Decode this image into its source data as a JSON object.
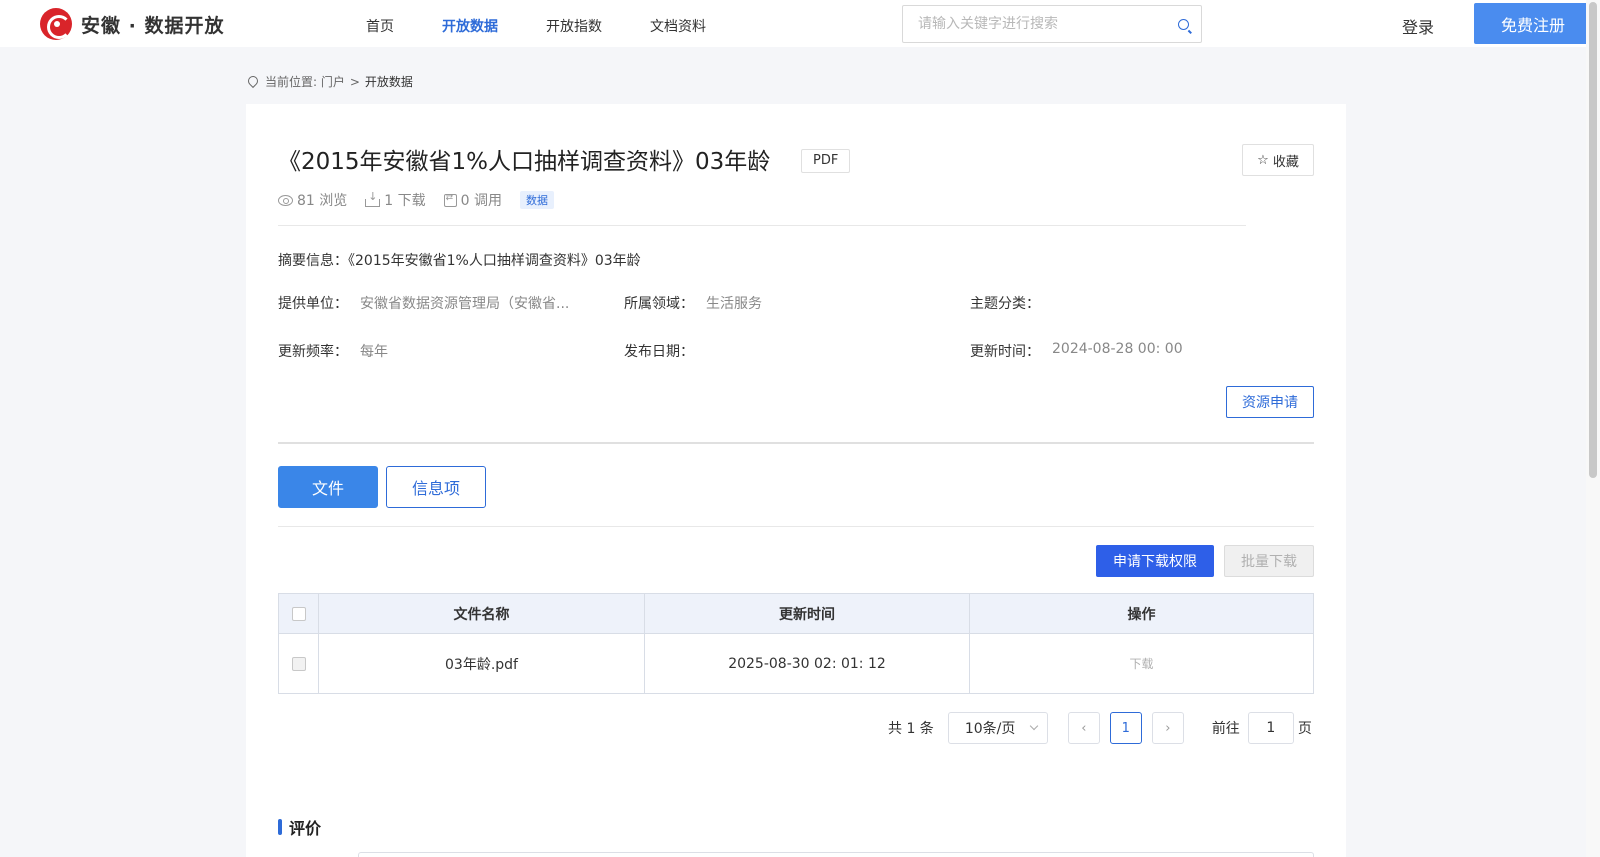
{
  "header": {
    "logo_text": "安徽 · 数据开放",
    "nav": [
      "首页",
      "开放数据",
      "开放指数",
      "文档资料"
    ],
    "search_placeholder": "请输入关键字进行搜索",
    "login": "登录",
    "register": "免费注册"
  },
  "breadcrumb": {
    "prefix": "当前位置: 门户",
    "sep": ">",
    "current": "开放数据"
  },
  "dataset": {
    "title": "《2015年安徽省1%人口抽样调查资料》03年龄",
    "format": "PDF",
    "favorite": "收藏",
    "views": "81 浏览",
    "downloads": "1 下载",
    "calls": "0 调用",
    "tag": "数据",
    "summary_label": "摘要信息：",
    "summary_value": "《2015年安徽省1%人口抽样调查资料》03年龄",
    "provider_label": "提供单位：",
    "provider_value": "安徽省数据资源管理局（安徽省...",
    "domain_label": "所属领域：",
    "domain_value": "生活服务",
    "topic_label": "主题分类：",
    "topic_value": "",
    "freq_label": "更新频率：",
    "freq_value": "每年",
    "publish_label": "发布日期：",
    "publish_value": "",
    "updated_label": "更新时间：",
    "updated_value": "2024-08-28 00: 00",
    "apply_btn": "资源申请"
  },
  "tabs": [
    "文件",
    "信息项"
  ],
  "actions": {
    "request_download": "申请下载权限",
    "batch_download": "批量下载"
  },
  "table": {
    "headers": [
      "文件名称",
      "更新时间",
      "操作"
    ],
    "rows": [
      {
        "name": "03年龄.pdf",
        "updated": "2025-08-30 02: 01: 12",
        "action": "下载"
      }
    ]
  },
  "pagination": {
    "total": "共 1 条",
    "page_size": "10条/页",
    "current_page": "1",
    "goto_label": "前往",
    "goto_value": "1",
    "page_unit": "页"
  },
  "review": {
    "title": "评价"
  },
  "colors": {
    "accent": "#2e6bd8",
    "brand_red": "#d9242a",
    "primary_button": "#2e5fe8"
  }
}
